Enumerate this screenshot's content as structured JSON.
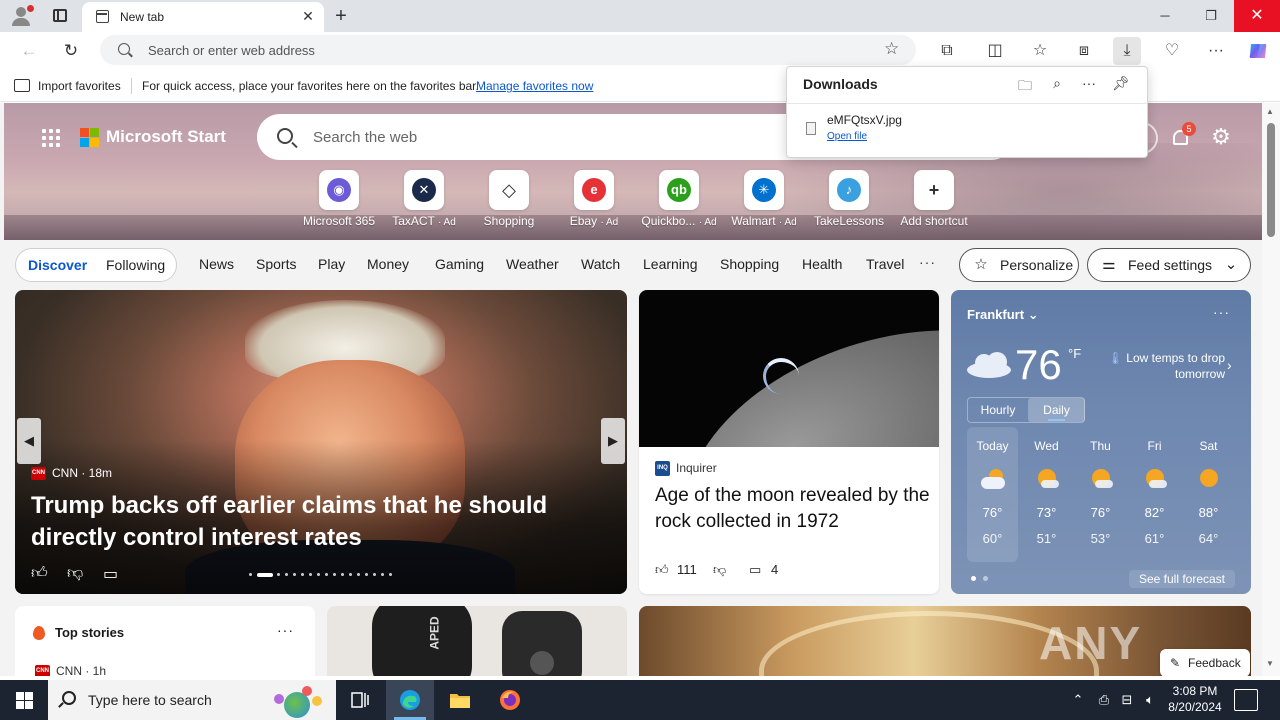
{
  "browser": {
    "tab_title": "New tab",
    "address_placeholder": "Search or enter web address",
    "window_controls": {
      "minimize": "─",
      "maximize": "❐",
      "close": "✕"
    }
  },
  "favorites_bar": {
    "import_label": "Import favorites",
    "hint": "For quick access, place your favorites here on the favorites bar.",
    "manage_link": "Manage favorites now"
  },
  "downloads": {
    "title": "Downloads",
    "file_name": "eMFQtsxV.jpg",
    "open_link": "Open file"
  },
  "start_page": {
    "brand": "Microsoft Start",
    "search_placeholder": "Search the web",
    "notification_count": "5",
    "shortcuts": [
      {
        "label": "Microsoft 365",
        "ad": "",
        "icon": "microsoft-365-icon",
        "color": "#6b5bd6",
        "glyph": "◉"
      },
      {
        "label": "TaxACT",
        "ad": "· Ad",
        "icon": "taxact-icon",
        "color": "#1b2a4a",
        "glyph": "✕"
      },
      {
        "label": "Shopping",
        "ad": "",
        "icon": "shopping-tag-icon",
        "color": "#ffffff",
        "glyph": "◇"
      },
      {
        "label": "Ebay",
        "ad": "· Ad",
        "icon": "ebay-icon",
        "color": "#e53238",
        "glyph": "e"
      },
      {
        "label": "Quickbo...",
        "ad": "· Ad",
        "icon": "quickbooks-icon",
        "color": "#2ca01c",
        "glyph": "qb"
      },
      {
        "label": "Walmart",
        "ad": "· Ad",
        "icon": "walmart-icon",
        "color": "#0071ce",
        "glyph": "✳"
      },
      {
        "label": "TakeLessons",
        "ad": "",
        "icon": "takelessons-icon",
        "color": "#3aa0e0",
        "glyph": "♪"
      },
      {
        "label": "Add shortcut",
        "ad": "",
        "icon": "plus-icon",
        "color": "#ffffff",
        "glyph": "+"
      }
    ]
  },
  "feed_nav": {
    "discover": "Discover",
    "following": "Following",
    "links": [
      "News",
      "Sports",
      "Play",
      "Money",
      "Gaming",
      "Weather",
      "Watch",
      "Learning",
      "Shopping",
      "Health",
      "Travel"
    ],
    "more": "···",
    "personalize": "Personalize",
    "feed_settings": "Feed settings"
  },
  "main_story": {
    "source": "CNN · 18m",
    "source_logo": "CNN",
    "headline": "Trump backs off earlier claims that he should directly control interest rates",
    "carousel_total": 17,
    "carousel_active_index": 1
  },
  "moon_story": {
    "publisher": "Inquirer",
    "publisher_logo": "INQ",
    "headline": "Age of the moon revealed by the rock collected in 1972",
    "likes": "111",
    "comments": "4"
  },
  "weather": {
    "city": "Frankfurt",
    "temperature": "76",
    "unit": "°F",
    "alert": "Low temps to drop tomorrow",
    "tab_hourly": "Hourly",
    "tab_daily": "Daily",
    "forecast": [
      {
        "day": "Today",
        "high": "76°",
        "low": "60°",
        "icon": "partly-cloudy-icon"
      },
      {
        "day": "Wed",
        "high": "73°",
        "low": "51°",
        "icon": "mostly-sunny-icon"
      },
      {
        "day": "Thu",
        "high": "76°",
        "low": "53°",
        "icon": "mostly-sunny-icon"
      },
      {
        "day": "Fri",
        "high": "82°",
        "low": "61°",
        "icon": "mostly-sunny-icon"
      },
      {
        "day": "Sat",
        "high": "88°",
        "low": "64°",
        "icon": "sunny-icon"
      }
    ],
    "full_forecast": "See full forecast"
  },
  "top_stories": {
    "title": "Top stories",
    "source": "CNN · 1h",
    "more": "···"
  },
  "shoe_card": {
    "text": "APED"
  },
  "overlay": {
    "watermark": "ANY RUN",
    "feedback": "Feedback"
  },
  "taskbar": {
    "search_placeholder": "Type here to search",
    "time": "3:08 PM",
    "date": "8/20/2024"
  }
}
